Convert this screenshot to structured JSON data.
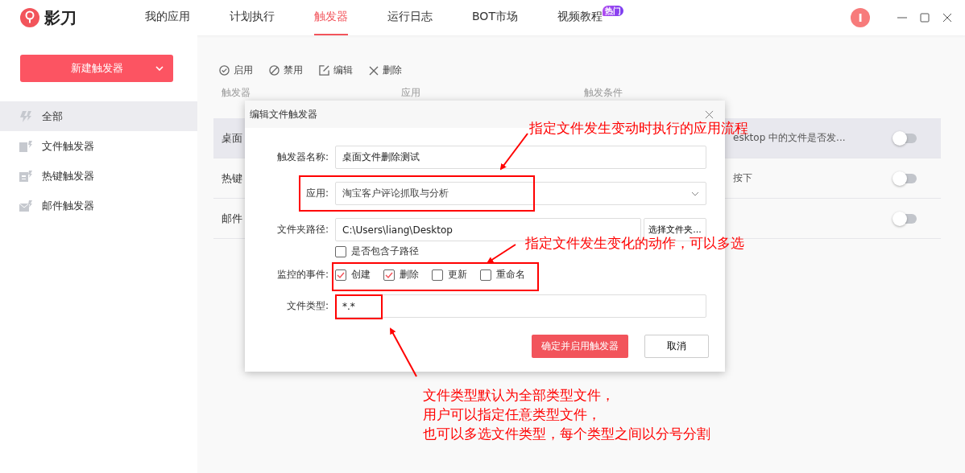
{
  "app": {
    "logo_text": "影刀"
  },
  "nav_tabs": [
    {
      "label": "我的应用",
      "selected": false
    },
    {
      "label": "计划执行",
      "selected": false
    },
    {
      "label": "触发器",
      "selected": true
    },
    {
      "label": "运行日志",
      "selected": false
    },
    {
      "label": "BOT市场",
      "selected": false
    },
    {
      "label": "视频教程",
      "selected": false,
      "badge": "热门"
    }
  ],
  "user": {
    "avatar_initial": "I"
  },
  "sidebar": {
    "new_button": "新建触发器",
    "items": [
      {
        "label": "全部",
        "selected": true,
        "kind": "all"
      },
      {
        "label": "文件触发器",
        "selected": false,
        "kind": "file"
      },
      {
        "label": "热键触发器",
        "selected": false,
        "kind": "hotkey"
      },
      {
        "label": "邮件触发器",
        "selected": false,
        "kind": "mail"
      }
    ]
  },
  "toolbar": [
    {
      "label": "启用",
      "kind": "enable"
    },
    {
      "label": "禁用",
      "kind": "disable"
    },
    {
      "label": "编辑",
      "kind": "edit"
    },
    {
      "label": "删除",
      "kind": "delete"
    }
  ],
  "table": {
    "columns": [
      "触发器",
      "应用",
      "触发条件"
    ],
    "rows": [
      {
        "name": "桌面",
        "condition": "esktop 中的文件是否发...",
        "on": false,
        "selected": true
      },
      {
        "name": "热键",
        "condition": "按下",
        "on": false,
        "selected": false
      },
      {
        "name": "邮件",
        "condition": "",
        "on": false,
        "selected": false
      }
    ]
  },
  "dialog": {
    "title": "编辑文件触发器",
    "name_label": "触发器名称:",
    "name_value": "桌面文件删除测试",
    "app_label": "应用:",
    "app_value": "淘宝客户评论抓取与分析",
    "path_label": "文件夹路径:",
    "path_value": "C:\\Users\\liang\\Desktop",
    "browse_button": "选择文件夹...",
    "subpath": {
      "label": "是否包含子路径",
      "checked": false
    },
    "events_label": "监控的事件:",
    "events": [
      {
        "label": "创建",
        "checked": true
      },
      {
        "label": "删除",
        "checked": true
      },
      {
        "label": "更新",
        "checked": false
      },
      {
        "label": "重命名",
        "checked": false
      }
    ],
    "filetype_label": "文件类型:",
    "filetype_value": "*.*",
    "confirm_button": "确定并启用触发器",
    "cancel_button": "取消"
  },
  "annotations": [
    {
      "text": "指定文件发生变动时执行的应用流程"
    },
    {
      "text": "指定文件发生变化的动作，可以多选"
    },
    {
      "lines": [
        "文件类型默认为全部类型文件，",
        "用户可以指定任意类型文件，",
        "也可以多选文件类型，每个类型之间以分号分割"
      ]
    }
  ]
}
